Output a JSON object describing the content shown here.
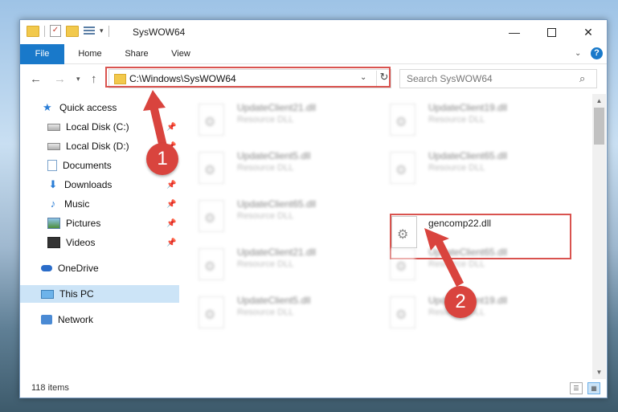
{
  "window": {
    "title": "SysWOW64"
  },
  "ribbon": {
    "tabs": [
      "File",
      "Home",
      "Share",
      "View"
    ],
    "help": "?"
  },
  "address": {
    "path": "C:\\Windows\\SysWOW64",
    "search_placeholder": "Search SysWOW64"
  },
  "sidebar": {
    "items": [
      {
        "label": "Quick access",
        "icon": "star-icon",
        "pinned": false
      },
      {
        "label": "Local Disk (C:)",
        "icon": "drive-icon",
        "pinned": true
      },
      {
        "label": "Local Disk (D:)",
        "icon": "drive-icon",
        "pinned": true
      },
      {
        "label": "Documents",
        "icon": "documents-icon",
        "pinned": true
      },
      {
        "label": "Downloads",
        "icon": "download-icon",
        "pinned": true
      },
      {
        "label": "Music",
        "icon": "music-icon",
        "pinned": true
      },
      {
        "label": "Pictures",
        "icon": "pictures-icon",
        "pinned": true
      },
      {
        "label": "Videos",
        "icon": "videos-icon",
        "pinned": true
      },
      {
        "label": "OneDrive",
        "icon": "onedrive-icon",
        "pinned": false
      },
      {
        "label": "This PC",
        "icon": "this-pc-icon",
        "pinned": false,
        "selected": true
      },
      {
        "label": "Network",
        "icon": "network-icon",
        "pinned": false
      }
    ]
  },
  "files": [
    {
      "name": "UpdateClient21.dll",
      "desc": "Resource DLL"
    },
    {
      "name": "UpdateClient19.dll",
      "desc": "Resource DLL"
    },
    {
      "name": "UpdateClient5.dll",
      "desc": "Resource DLL"
    },
    {
      "name": "UpdateClient65.dll",
      "desc": "Resource DLL"
    },
    {
      "name": "UpdateClient65.dll",
      "desc": "Resource DLL"
    },
    {
      "name": "gencomp22.dll",
      "desc": ""
    },
    {
      "name": "UpdateClient21.dll",
      "desc": "Resource DLL"
    },
    {
      "name": "UpdateClient65.dll",
      "desc": "Resource DLL"
    },
    {
      "name": "UpdateClient5.dll",
      "desc": "Resource DLL"
    },
    {
      "name": "UpdateClient19.dll",
      "desc": "Resource DLL"
    }
  ],
  "status": {
    "item_count": "118 items"
  },
  "annotations": {
    "step1": "1",
    "step2": "2",
    "color": "#d9443e"
  }
}
